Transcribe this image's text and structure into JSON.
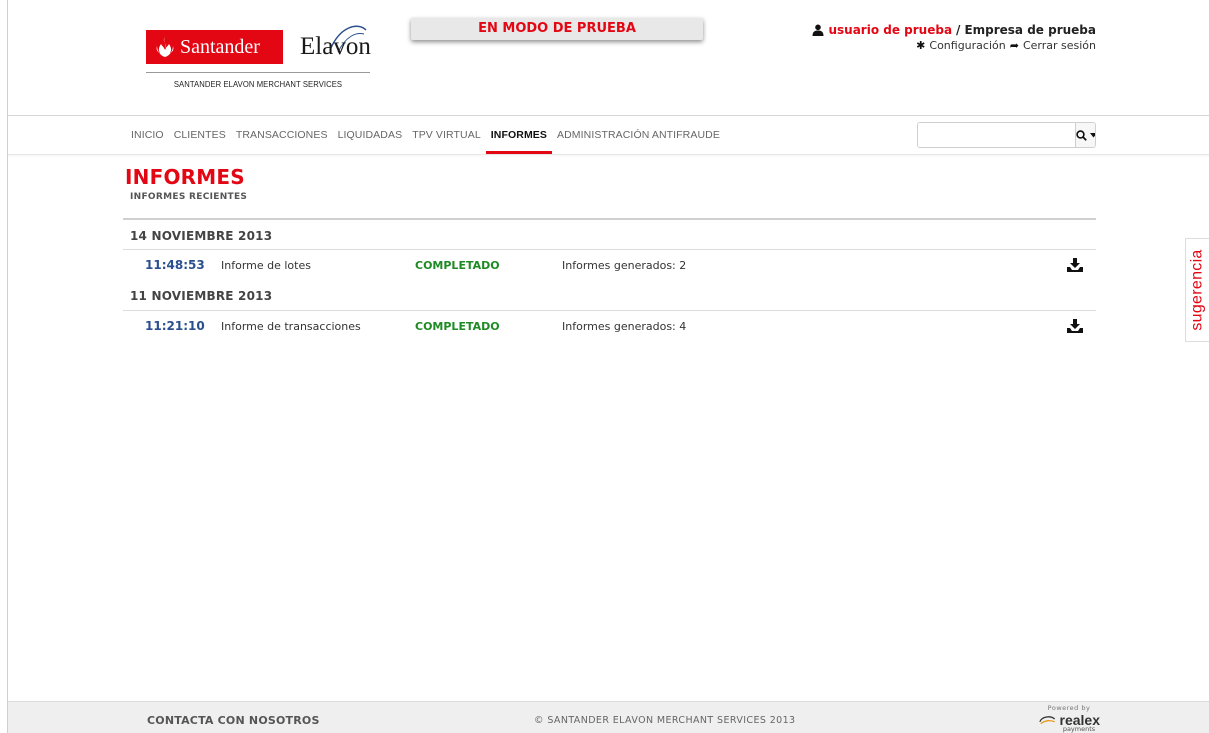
{
  "header": {
    "logo": {
      "santander": "Santander",
      "elavon": "Elavon",
      "subtitle": "SANTANDER ELAVON MERCHANT SERVICES"
    },
    "test_banner": "EN MODO DE PRUEBA",
    "user": {
      "name": "usuario de prueba",
      "separator": "/",
      "company": "Empresa de prueba"
    },
    "settings_label": "Configuración",
    "logout_label": "Cerrar sesión"
  },
  "nav": {
    "items": [
      {
        "label": "INICIO",
        "active": false
      },
      {
        "label": "CLIENTES",
        "active": false
      },
      {
        "label": "TRANSACCIONES",
        "active": false
      },
      {
        "label": "LIQUIDADAS",
        "active": false
      },
      {
        "label": "TPV VIRTUAL",
        "active": false
      },
      {
        "label": "INFORMES",
        "active": true
      },
      {
        "label": "ADMINISTRACIÓN ANTIFRAUDE",
        "active": false
      }
    ],
    "search": {
      "value": "",
      "placeholder": ""
    }
  },
  "page": {
    "title": "INFORMES",
    "subtitle": "INFORMES RECIENTES"
  },
  "report_groups": [
    {
      "date": "14 NOVIEMBRE 2013",
      "reports": [
        {
          "time": "11:48:53",
          "name": "Informe de lotes",
          "status": "COMPLETADO",
          "count": "Informes generados: 2"
        }
      ]
    },
    {
      "date": "11 NOVIEMBRE 2013",
      "reports": [
        {
          "time": "11:21:10",
          "name": "Informe de transacciones",
          "status": "COMPLETADO",
          "count": "Informes generados: 4"
        }
      ]
    }
  ],
  "feedback_tab": "sugerencia",
  "footer": {
    "contact": "CONTACTA CON NOSOTROS",
    "copyright": "© SANTANDER ELAVON MERCHANT SERVICES 2013",
    "powered_by": "Powered by",
    "realex": "realex",
    "payments": "payments"
  },
  "colors": {
    "brand_red": "#e30613",
    "status_green": "#1e8a23",
    "time_blue": "#2a4f8f"
  }
}
